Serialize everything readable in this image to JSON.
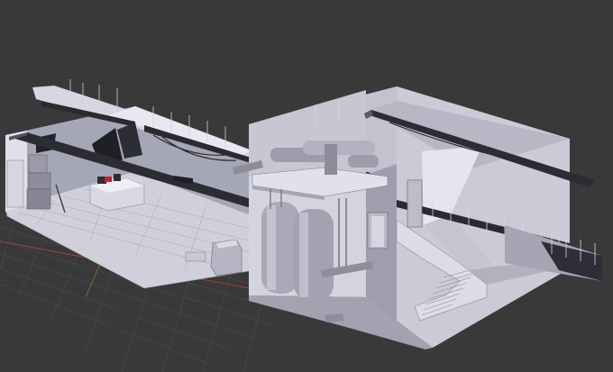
{
  "app": {
    "name": "3D Viewport",
    "background_color": "#393939"
  },
  "view": {
    "mode": "solid",
    "grid_visible": true,
    "axis_x_color": "#b03a3a",
    "axis_y_color": "#4f7f3a"
  },
  "scene": {
    "objects": [
      {
        "name": "industrial-room-left"
      },
      {
        "name": "industrial-room-right"
      },
      {
        "name": "ceiling-pipe-left"
      },
      {
        "name": "ceiling-pipe-right"
      },
      {
        "name": "boiler-tanks"
      },
      {
        "name": "staircase"
      },
      {
        "name": "control-desk"
      },
      {
        "name": "machinery-cart"
      },
      {
        "name": "fan-units"
      }
    ]
  },
  "palette": {
    "wall_light": "#c9c9d6",
    "wall_mid": "#9b9bab",
    "wall_dark": "#6d6d7a",
    "floor": "#b8b8c6",
    "pipe_dark": "#2c2c34",
    "pipe_light": "#8b8b97",
    "accent_red": "#c0242a"
  }
}
